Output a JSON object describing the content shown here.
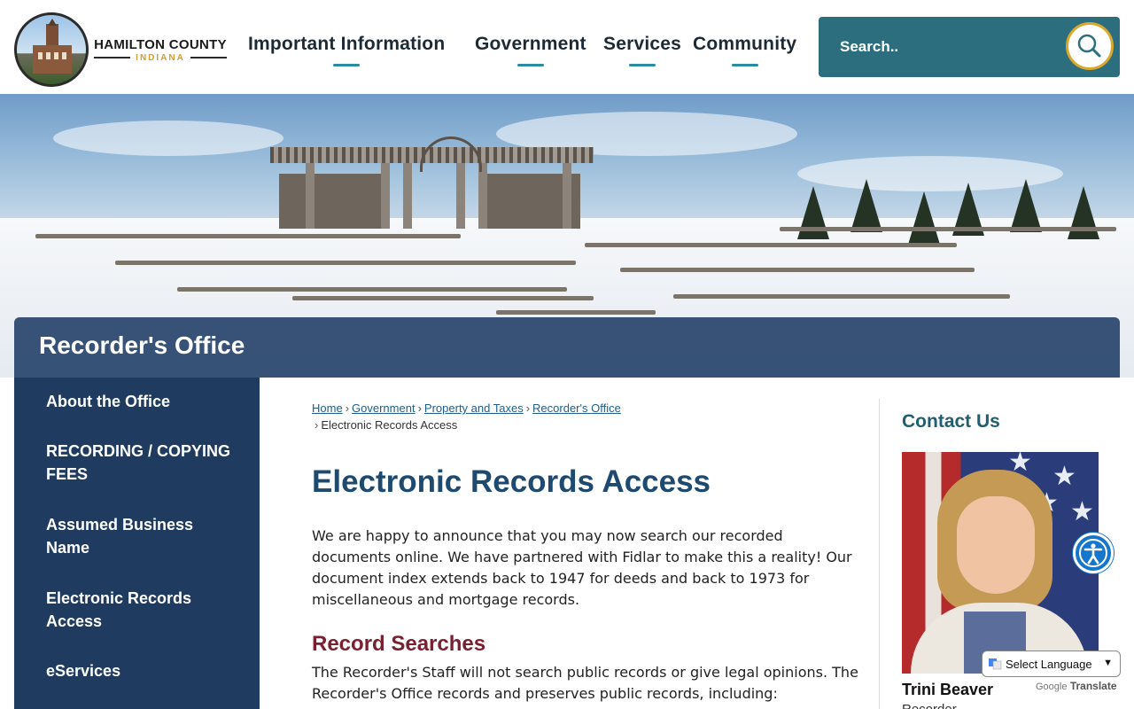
{
  "header": {
    "logo": {
      "county": "HAMILTON COUNTY",
      "state": "INDIANA"
    },
    "nav": [
      {
        "label": "Important Information"
      },
      {
        "label": "Government"
      },
      {
        "label": "Services"
      },
      {
        "label": "Community"
      }
    ],
    "search": {
      "placeholder": "Search.."
    }
  },
  "hero": {
    "office_title": "Recorder's Office"
  },
  "sidebar": {
    "items": [
      {
        "label": "About the Office"
      },
      {
        "label": "RECORDING / COPYING FEES"
      },
      {
        "label": "Assumed Business Name"
      },
      {
        "label": "Electronic Records Access"
      },
      {
        "label": "eServices"
      }
    ]
  },
  "breadcrumb": {
    "links": [
      "Home",
      "Government",
      "Property and Taxes",
      "Recorder's Office"
    ],
    "current": "Electronic Records Access"
  },
  "main": {
    "title": "Electronic Records Access",
    "intro": "We are happy to announce that you may now search our recorded documents online. We have partnered with Fidlar to make this a reality! Our document index extends back to 1947 for deeds and back to 1973 for miscellaneous and mortgage records.",
    "section_heading": "Record Searches",
    "section_text": "The Recorder's Staff will not search public records or give legal opinions. The Recorder's Office records and preserves public records, including:"
  },
  "contact": {
    "heading": "Contact Us",
    "name": "Trini Beaver",
    "role": "Recorder"
  },
  "widgets": {
    "translate_label": "Select Language",
    "powered_by": "Google",
    "translate_word": "Translate"
  },
  "colors": {
    "navy": "#1f3c60",
    "teal": "#2d6e7e",
    "gold": "#d9a92e",
    "title_blue": "#1f4a70",
    "heading_maroon": "#7a2030"
  }
}
